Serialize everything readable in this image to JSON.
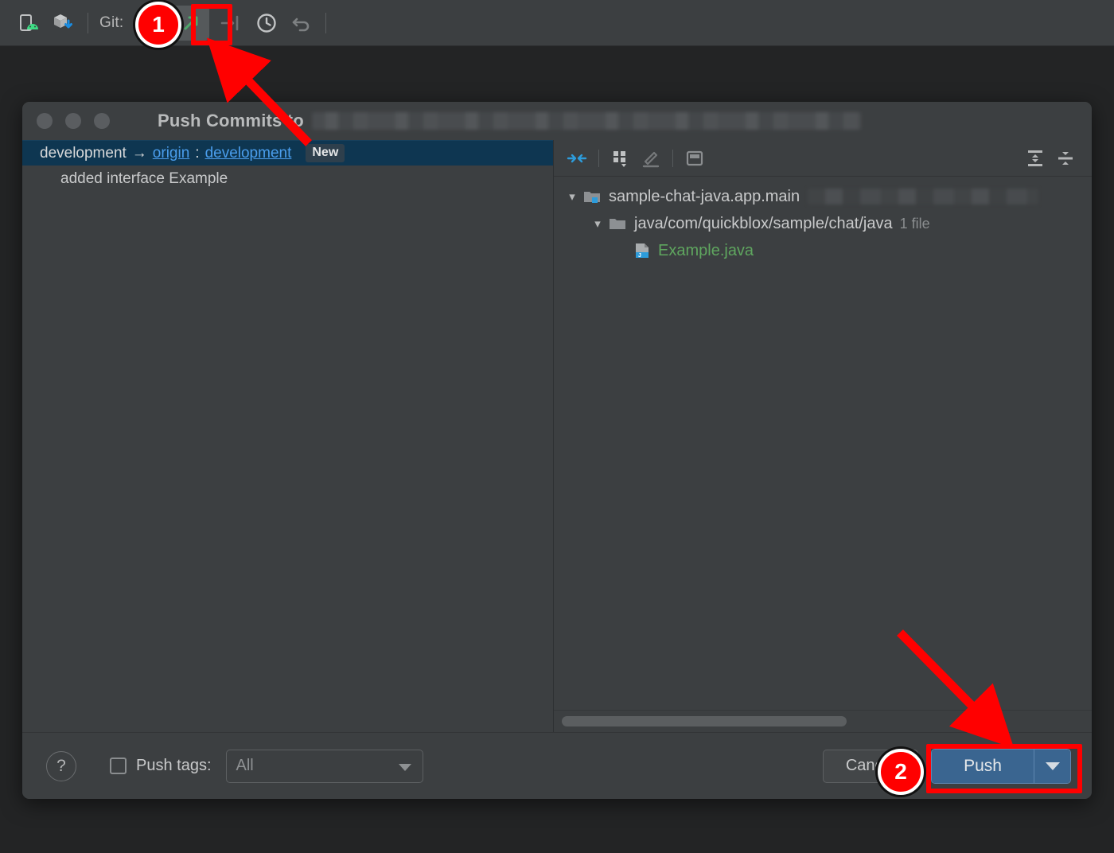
{
  "ide_toolbar": {
    "icons": [
      {
        "name": "android-device-manager-icon",
        "glyph": "device"
      },
      {
        "name": "gradle-sync-icon",
        "glyph": "cube-download"
      }
    ],
    "git_label": "Git:",
    "actions": [
      {
        "name": "git-push-icon",
        "glyph": "arrow-up-right",
        "active": true
      },
      {
        "name": "git-update-project-icon",
        "glyph": "arrow-into-line"
      },
      {
        "name": "git-history-icon",
        "glyph": "clock"
      },
      {
        "name": "git-rollback-icon",
        "glyph": "undo"
      }
    ]
  },
  "dialog": {
    "title": "Push Commits to",
    "title_redacted": true,
    "window_controls": [
      "close",
      "minimize",
      "zoom"
    ],
    "commits": {
      "branch_row": {
        "local_branch": "development",
        "arrow": "→",
        "remote": "origin",
        "separator": ":",
        "remote_branch": "development",
        "badge": "New"
      },
      "commit_messages": [
        "added interface Example"
      ]
    },
    "files": {
      "toolbar": [
        {
          "name": "collapse-diff-icon",
          "glyph": "arrows-in"
        },
        {
          "name": "group-by-icon",
          "glyph": "grid-dropdown"
        },
        {
          "name": "edit-source-icon",
          "glyph": "pencil"
        },
        {
          "name": "preview-diff-icon",
          "glyph": "panel"
        },
        {
          "name": "expand-all-icon",
          "glyph": "expand"
        },
        {
          "name": "collapse-all-icon",
          "glyph": "collapse"
        }
      ],
      "tree": [
        {
          "label": "sample-chat-java.app.main",
          "type": "module",
          "redacted_suffix": true,
          "expanded": true
        },
        {
          "label": "java/com/quickblox/sample/chat/java",
          "type": "directory",
          "count": "1 file",
          "expanded": true
        },
        {
          "label": "Example.java",
          "type": "java-file",
          "status_color": "#5FA65F"
        }
      ]
    },
    "footer": {
      "help_label": "?",
      "push_tags_label": "Push tags:",
      "push_tags_checked": false,
      "tags_value": "All",
      "cancel_label": "Cancel",
      "push_label": "Push",
      "push_dropdown": "▼"
    }
  },
  "annotations": {
    "markers": [
      {
        "name": "step-1-marker",
        "number": "1"
      },
      {
        "name": "step-2-marker",
        "number": "2"
      }
    ],
    "accent_color": "#FF0000"
  }
}
